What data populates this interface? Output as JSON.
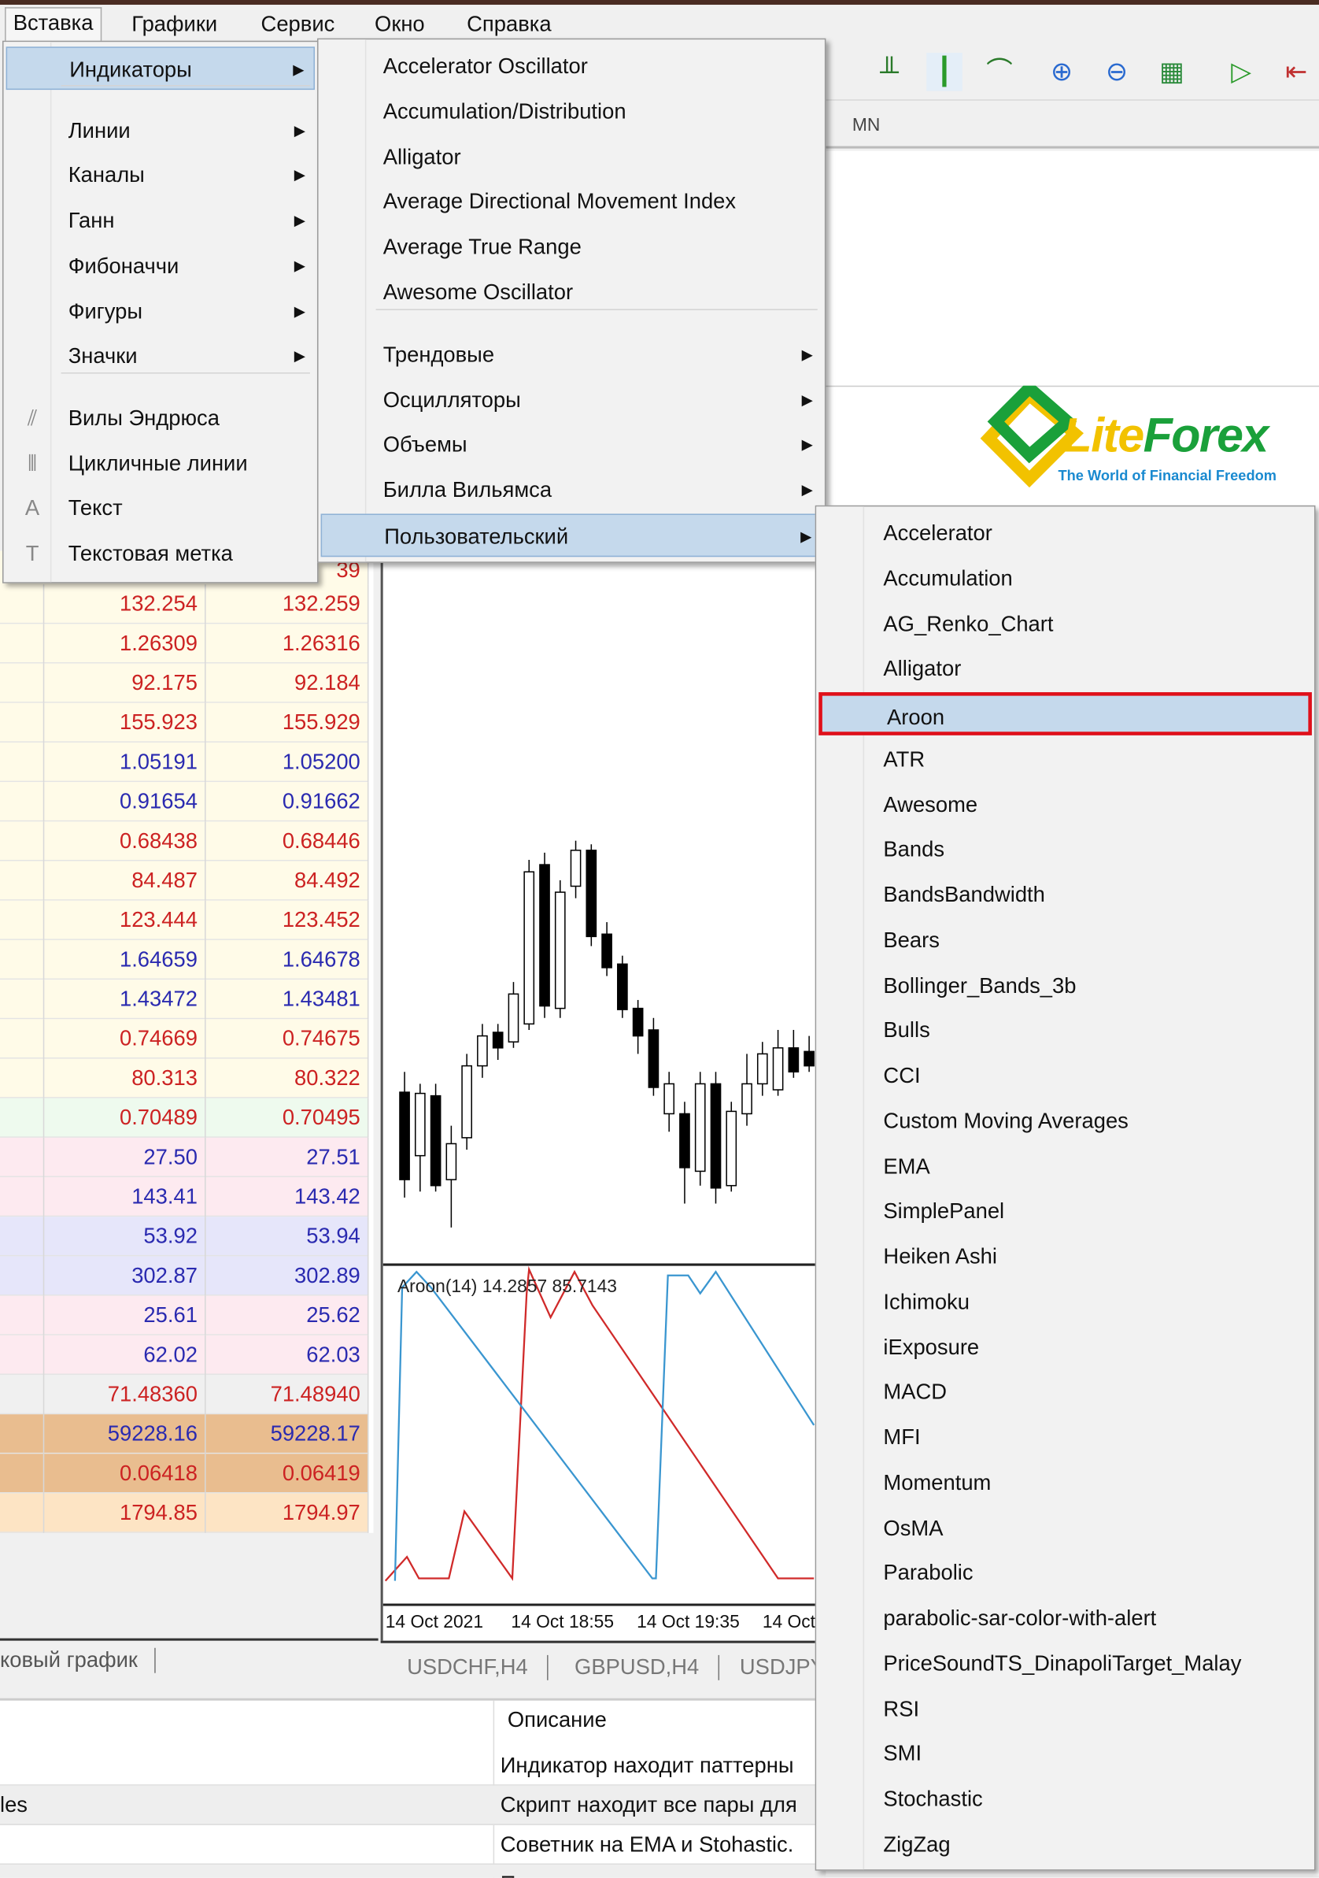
{
  "menubar": {
    "items": [
      "Вставка",
      "Графики",
      "Сервис",
      "Окно",
      "Справка"
    ],
    "active": "Вставка"
  },
  "toolbar": {
    "icons": [
      "bar-chart-icon",
      "candlestick-chart-icon",
      "line-chart-icon",
      "zoom-in-icon",
      "zoom-out-icon",
      "tile-windows-icon",
      "chart-shift-icon",
      "autoscroll-icon"
    ]
  },
  "timeframes": {
    "visible": [
      "MN"
    ]
  },
  "logo": {
    "text": "LiteForex",
    "tagline": "The World of Financial Freedom"
  },
  "market_watch": {
    "partial_top": "39",
    "rows": [
      {
        "bid": "132.254",
        "ask": "132.259",
        "color": "#cc2222",
        "bg": "#fffbe8"
      },
      {
        "bid": "1.26309",
        "ask": "1.26316",
        "color": "#cc2222",
        "bg": "#fffbe8"
      },
      {
        "bid": "92.175",
        "ask": "92.184",
        "color": "#cc2222",
        "bg": "#fffbe8"
      },
      {
        "bid": "155.923",
        "ask": "155.929",
        "color": "#cc2222",
        "bg": "#fffbe8"
      },
      {
        "bid": "1.05191",
        "ask": "1.05200",
        "color": "#2a2ab0",
        "bg": "#fffbe8"
      },
      {
        "bid": "0.91654",
        "ask": "0.91662",
        "color": "#2a2ab0",
        "bg": "#fffbe8"
      },
      {
        "bid": "0.68438",
        "ask": "0.68446",
        "color": "#cc2222",
        "bg": "#fffbe8"
      },
      {
        "bid": "84.487",
        "ask": "84.492",
        "color": "#cc2222",
        "bg": "#fffbe8"
      },
      {
        "bid": "123.444",
        "ask": "123.452",
        "color": "#cc2222",
        "bg": "#fffbe8"
      },
      {
        "bid": "1.64659",
        "ask": "1.64678",
        "color": "#2a2ab0",
        "bg": "#fffbe8"
      },
      {
        "bid": "1.43472",
        "ask": "1.43481",
        "color": "#2a2ab0",
        "bg": "#fffbe8"
      },
      {
        "bid": "0.74669",
        "ask": "0.74675",
        "color": "#cc2222",
        "bg": "#fffbe8"
      },
      {
        "bid": "80.313",
        "ask": "80.322",
        "color": "#cc2222",
        "bg": "#fffbe8"
      },
      {
        "bid": "0.70489",
        "ask": "0.70495",
        "color": "#cc2222",
        "bg": "#eefaee"
      },
      {
        "bid": "27.50",
        "ask": "27.51",
        "color": "#2a2ab0",
        "bg": "#fdeaf0"
      },
      {
        "bid": "143.41",
        "ask": "143.42",
        "color": "#2a2ab0",
        "bg": "#fdeaf0"
      },
      {
        "bid": "53.92",
        "ask": "53.94",
        "color": "#2a2ab0",
        "bg": "#e6e6fa"
      },
      {
        "bid": "302.87",
        "ask": "302.89",
        "color": "#2a2ab0",
        "bg": "#e6e6fa"
      },
      {
        "bid": "25.61",
        "ask": "25.62",
        "color": "#2a2ab0",
        "bg": "#fdeaf0"
      },
      {
        "bid": "62.02",
        "ask": "62.03",
        "color": "#2a2ab0",
        "bg": "#fdeaf0"
      },
      {
        "bid": "71.48360",
        "ask": "71.48940",
        "color": "#cc2222",
        "bg": "#f0f0f0"
      },
      {
        "bid": "59228.16",
        "ask": "59228.17",
        "color": "#2a2ab0",
        "bg": "#e9bd8f"
      },
      {
        "bid": "0.06418",
        "ask": "0.06419",
        "color": "#cc2222",
        "bg": "#e9bd8f"
      },
      {
        "bid": "1794.85",
        "ask": "1794.97",
        "color": "#cc2222",
        "bg": "#fde4c4"
      }
    ],
    "tab_label": "ковый график"
  },
  "chart": {
    "indicator_label": "Aroon(14) 14.2857 85.7143",
    "time_labels": [
      "14 Oct 2021",
      "14 Oct 18:55",
      "14 Oct 19:35",
      "14 Oct"
    ],
    "tabs": [
      "USDCHF,H4",
      "GBPUSD,H4",
      "USDJPY"
    ],
    "colors": {
      "aroon_up": "#3a96d0",
      "aroon_down": "#d02a2a"
    }
  },
  "bottom_table": {
    "header": "Описание",
    "rows": [
      {
        "name": "",
        "desc": "Индикатор находит паттерны"
      },
      {
        "name": "les",
        "desc": "Скрипт находит все пары для"
      },
      {
        "name": "",
        "desc": "Советник на EMA и Stohastic."
      },
      {
        "name": "",
        "desc": "П"
      }
    ]
  },
  "insert_menu": {
    "items": [
      {
        "label": "Индикаторы",
        "submenu": true,
        "highlighted": true
      },
      {
        "separator": true
      },
      {
        "label": "Линии",
        "submenu": true
      },
      {
        "label": "Каналы",
        "submenu": true
      },
      {
        "label": "Ганн",
        "submenu": true
      },
      {
        "label": "Фибоначчи",
        "submenu": true
      },
      {
        "label": "Фигуры",
        "submenu": true
      },
      {
        "label": "Значки",
        "submenu": true
      },
      {
        "separator": true
      },
      {
        "label": "Вилы Эндрюса",
        "icon": "andrews-pitchfork-icon",
        "glyph": "⫽"
      },
      {
        "label": "Цикличные линии",
        "icon": "cycle-lines-icon",
        "glyph": "⦀"
      },
      {
        "label": "Текст",
        "icon": "text-icon",
        "glyph": "A"
      },
      {
        "label": "Текстовая метка",
        "icon": "text-label-icon",
        "glyph": "T"
      }
    ]
  },
  "indicators_menu": {
    "items": [
      {
        "label": "Accelerator Oscillator"
      },
      {
        "label": "Accumulation/Distribution"
      },
      {
        "label": "Alligator"
      },
      {
        "label": "Average Directional Movement Index"
      },
      {
        "label": "Average True Range"
      },
      {
        "label": "Awesome Oscillator"
      },
      {
        "separator": true
      },
      {
        "label": "Трендовые",
        "submenu": true
      },
      {
        "label": "Осцилляторы",
        "submenu": true
      },
      {
        "label": "Объемы",
        "submenu": true
      },
      {
        "label": "Билла Вильямса",
        "submenu": true
      },
      {
        "label": "Пользовательский",
        "submenu": true,
        "highlighted": true
      }
    ]
  },
  "custom_menu": {
    "selected": "Aroon",
    "items": [
      "Accelerator",
      "Accumulation",
      "AG_Renko_Chart",
      "Alligator",
      "Aroon",
      "ATR",
      "Awesome",
      "Bands",
      "BandsBandwidth",
      "Bears",
      "Bollinger_Bands_3b",
      "Bulls",
      "CCI",
      "Custom Moving Averages",
      "EMA",
      "SimplePanel",
      "Heiken Ashi",
      "Ichimoku",
      "iExposure",
      "MACD",
      "MFI",
      "Momentum",
      "OsMA",
      "Parabolic",
      "parabolic-sar-color-with-alert",
      "PriceSoundTS_DinapoliTarget_Malay",
      "RSI",
      "SMI",
      "Stochastic",
      "ZigZag"
    ]
  }
}
